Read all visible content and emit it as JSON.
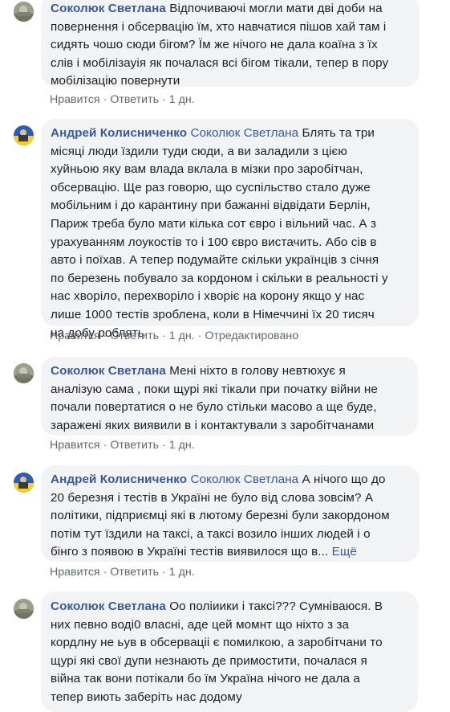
{
  "comments": [
    {
      "author": "Соколюк Светлана",
      "mention": "",
      "text": "Відпочиваючі могли мати дві доби на\nповернення і обсервацію їм, хто навчатися пішов хай там і\nсидять чошо сюди бігом? Їм же нічого не дала коаїна з їх\nслів і мобілізауія як почалася всі бігом тікали, тепер в пору\nмобілізацію повернути",
      "more": "",
      "like": "Нравится",
      "reply": "Ответить",
      "time": "1 дн.",
      "avatar": "photo"
    },
    {
      "author": "Андрей Колисниченко",
      "mention": "Соколюк Светлана",
      "text": "Блять та три\nмісяці люди їздили туди сюди, а ви заладили з цією\nхуйньою яку вам влада вклала в мізки про заробітчан,\nобсервацію. Ще раз говорю, що суспільство стало дуже\nмобільним і до карантину при бажанні відвідати Берлін,\nПариж треба було мати кілька сот євро і вільний час. А з\nурахуванням лоукостів то і 100 євро вистачить. Або сів в\nавто і поїхав. А тепер подумайте скільки українців з січня\nпо березень побувало за кордоном і скільки в реальності у\nнас хворіло, перехворіло і хворіє на корону якщо у нас\nлише 1000 тестів зроблена, коли в Німеччині їх 20 тисяч\nна добу роблять",
      "more": "",
      "like": "Нравится",
      "reply": "Ответить",
      "time": "1 дн.",
      "edited": "Отредактировано",
      "avatar": "flag"
    },
    {
      "author": "Соколюк Светлана",
      "mention": "",
      "text": "Мені ніхто в голову невтюхує я\nаналізую сама , поки щурі які тікали при початку війни не\nпочали повертатися о не було стільки масово а ще буде,\nзаражені яких виявили в і контактували з заробітчанами",
      "more": "",
      "like": "Нравится",
      "reply": "Ответить",
      "time": "1 дн.",
      "avatar": "photo"
    },
    {
      "author": "Андрей Колисниченко",
      "mention": "Соколюк Светлана",
      "text": "А нічого що до\n20 березня і тестів в Україні не було від слова зовсім? А\nполітики, підприємці які в лютому березні були закордоном\nпотім тут їздили на таксі, а таксі возило інших людей і о\nбінго з появою в Україні тестів виявилося що в...",
      "more": "Ещё",
      "like": "Нравится",
      "reply": "Ответить",
      "time": "1 дн.",
      "avatar": "flag"
    },
    {
      "author": "Соколюк Светлана",
      "mention": "",
      "text": "Оо поліиики і таксі??? Сумніваюся. В\nних певно воді0 власні, аде цей момнт що ніхто з за\nкордлну не ьув в обсерваціі є помилкою, а заробітчани то\nщурі які свої дупи незнають де примостити, почалася я\nвійна так вони потікали бо їм Україна нічого не дала а\nтепер виють заберіть нас додому",
      "more": "",
      "like": "",
      "reply": "",
      "time": "",
      "avatar": "photo"
    }
  ]
}
